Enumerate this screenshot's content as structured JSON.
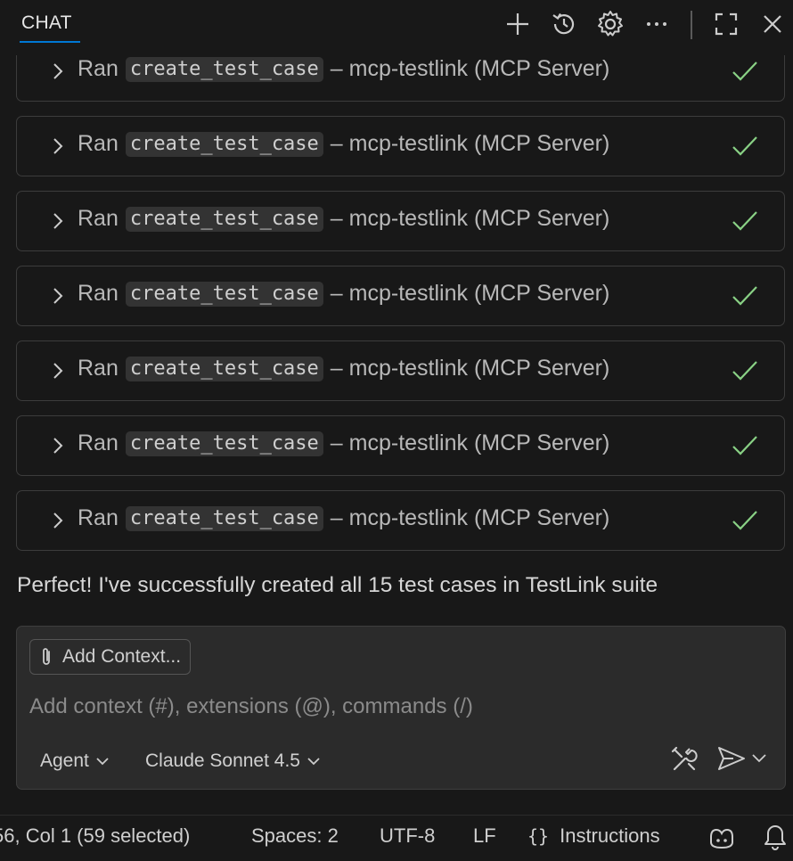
{
  "header": {
    "tab_label": "CHAT",
    "icons": [
      "plus-icon",
      "history-icon",
      "gear-icon",
      "more-icon",
      "maximize-icon",
      "close-icon"
    ]
  },
  "tool_calls": [
    {
      "prefix": "Ran",
      "tool": "create_test_case",
      "suffix": "– mcp-testlink (MCP Server)",
      "status": "success"
    },
    {
      "prefix": "Ran",
      "tool": "create_test_case",
      "suffix": "– mcp-testlink (MCP Server)",
      "status": "success"
    },
    {
      "prefix": "Ran",
      "tool": "create_test_case",
      "suffix": "– mcp-testlink (MCP Server)",
      "status": "success"
    },
    {
      "prefix": "Ran",
      "tool": "create_test_case",
      "suffix": "– mcp-testlink (MCP Server)",
      "status": "success"
    },
    {
      "prefix": "Ran",
      "tool": "create_test_case",
      "suffix": "– mcp-testlink (MCP Server)",
      "status": "success"
    },
    {
      "prefix": "Ran",
      "tool": "create_test_case",
      "suffix": "– mcp-testlink (MCP Server)",
      "status": "success"
    },
    {
      "prefix": "Ran",
      "tool": "create_test_case",
      "suffix": "– mcp-testlink (MCP Server)",
      "status": "success"
    }
  ],
  "message": {
    "text": "Perfect! I've successfully created all 15 test cases in TestLink suite"
  },
  "input": {
    "add_context_label": "Add Context...",
    "placeholder": "Add context (#), extensions (@), commands (/)",
    "value": "",
    "mode_label": "Agent",
    "model_label": "Claude Sonnet 4.5"
  },
  "status_bar": {
    "position": "56, Col 1 (59 selected)",
    "spaces": "Spaces: 2",
    "encoding": "UTF-8",
    "eol": "LF",
    "language": "Instructions"
  },
  "colors": {
    "background": "#181818",
    "accent": "#0078d4",
    "success": "#89d185",
    "input_bg": "#2b2b2b"
  }
}
